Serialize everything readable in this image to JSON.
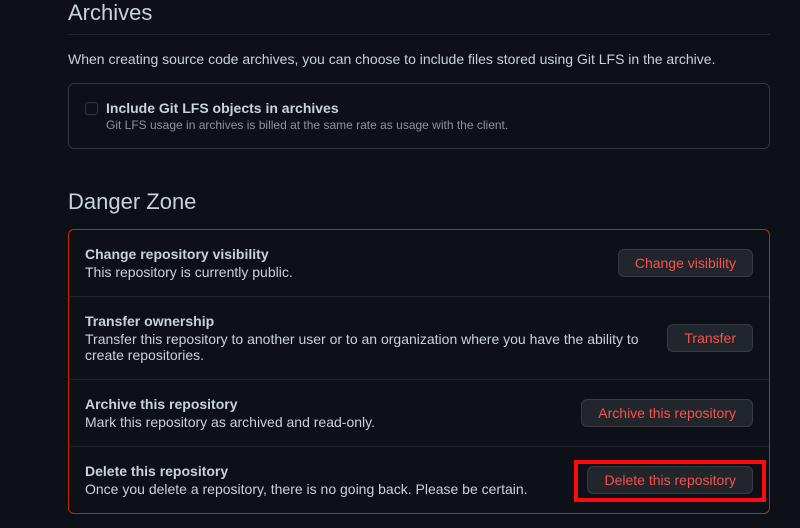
{
  "archives": {
    "title": "Archives",
    "description": "When creating source code archives, you can choose to include files stored using Git LFS in the archive.",
    "checkbox": {
      "label": "Include Git LFS objects in archives",
      "help": "Git LFS usage in archives is billed at the same rate as usage with the client."
    }
  },
  "danger_zone": {
    "title": "Danger Zone",
    "items": [
      {
        "title": "Change repository visibility",
        "description": "This repository is currently public.",
        "button": "Change visibility"
      },
      {
        "title": "Transfer ownership",
        "description": "Transfer this repository to another user or to an organization where you have the ability to create repositories.",
        "button": "Transfer"
      },
      {
        "title": "Archive this repository",
        "description": "Mark this repository as archived and read-only.",
        "button": "Archive this repository"
      },
      {
        "title": "Delete this repository",
        "description": "Once you delete a repository, there is no going back. Please be certain.",
        "button": "Delete this repository"
      }
    ]
  }
}
